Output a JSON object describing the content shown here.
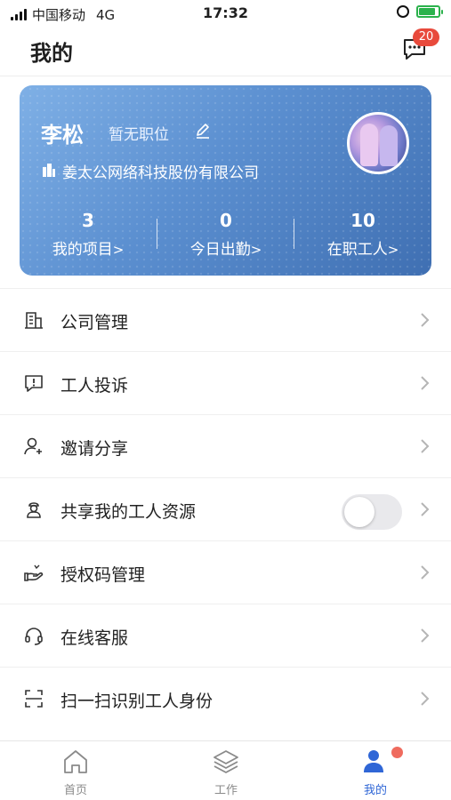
{
  "status_bar": {
    "carrier": "中国移动",
    "network": "4G",
    "time": "17:32"
  },
  "header": {
    "title": "我的",
    "message_count": "20"
  },
  "profile": {
    "name": "李松",
    "position": "暂无职位",
    "company": "姜太公网络科技股份有限公司",
    "stats": [
      {
        "value": "3",
        "label": "我的项目"
      },
      {
        "value": "0",
        "label": "今日出勤"
      },
      {
        "value": "10",
        "label": "在职工人"
      }
    ],
    "card_colors": [
      "#7fb0e6",
      "#3f6fb2"
    ]
  },
  "menu": [
    {
      "label": "公司管理",
      "icon": "building-icon"
    },
    {
      "label": "工人投诉",
      "icon": "complaint-icon"
    },
    {
      "label": "邀请分享",
      "icon": "add-user-icon"
    },
    {
      "label": "共享我的工人资源",
      "icon": "worker-icon",
      "toggle": false
    },
    {
      "label": "授权码管理",
      "icon": "hand-icon"
    },
    {
      "label": "在线客服",
      "icon": "headset-icon"
    },
    {
      "label": "扫一扫识别工人身份",
      "icon": "scan-icon"
    }
  ],
  "tabs": [
    {
      "label": "首页",
      "icon": "home-icon",
      "active": false
    },
    {
      "label": "工作",
      "icon": "layers-icon",
      "active": false
    },
    {
      "label": "我的",
      "icon": "person-icon",
      "active": true
    }
  ],
  "colors": {
    "accent": "#2f66d6",
    "badge": "#e84a3c"
  }
}
